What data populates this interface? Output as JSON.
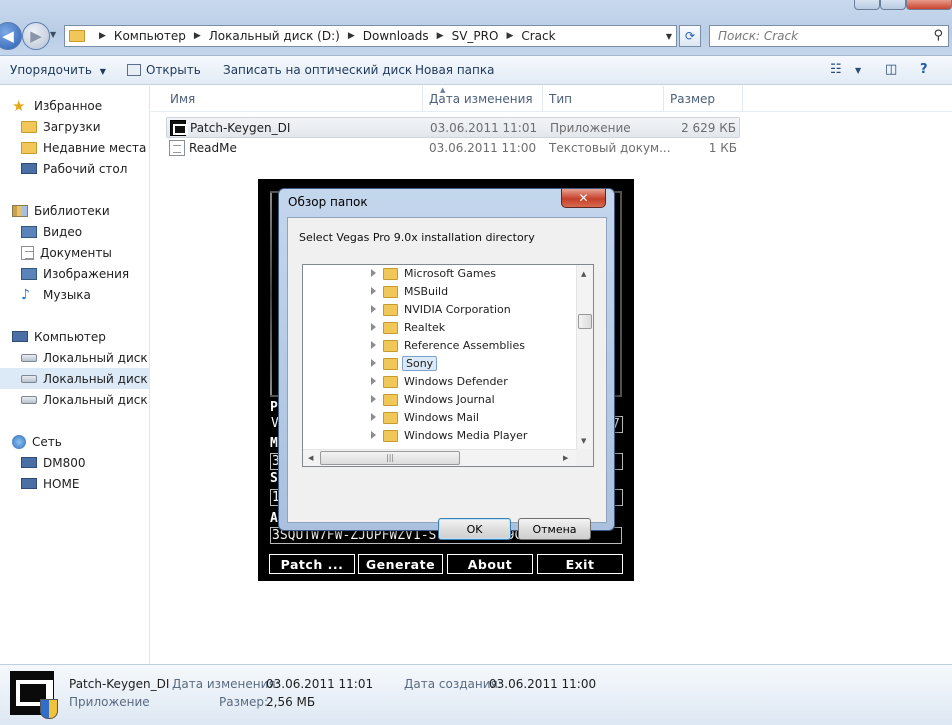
{
  "explorer": {
    "address": {
      "crumbs": [
        "Компьютер",
        "Локальный диск (D:)",
        "Downloads",
        "SV_PRO",
        "Crack"
      ]
    },
    "search": {
      "placeholder": "Поиск: Crack"
    },
    "toolbar": {
      "organize": "Упорядочить",
      "open": "Открыть",
      "burn": "Записать на оптический диск",
      "new_folder": "Новая папка"
    },
    "nav": {
      "favorites": "Избранное",
      "downloads": "Загрузки",
      "recent": "Недавние места",
      "desktop": "Рабочий стол",
      "libraries": "Библиотеки",
      "video": "Видео",
      "documents": "Документы",
      "images": "Изображения",
      "music": "Музыка",
      "computer": "Компьютер",
      "drive_c": "Локальный диск (C:)",
      "drive_d": "Локальный диск (D:)",
      "drive_e": "Локальный диск (E:)",
      "network": "Сеть",
      "dm800": "DM800",
      "home": "HOME"
    },
    "columns": {
      "name": "Имя",
      "date": "Дата изменения",
      "type": "Тип",
      "size": "Размер"
    },
    "files": [
      {
        "name": "Patch-Keygen_DI",
        "date": "03.06.2011 11:01",
        "type": "Приложение",
        "size": "2 629 КБ"
      },
      {
        "name": "ReadMe",
        "date": "03.06.2011 11:00",
        "type": "Текстовый докум...",
        "size": "1 КБ"
      }
    ],
    "details": {
      "name": "Patch-Keygen_DI",
      "kind": "Приложение",
      "modified_label": "Дата изменения:",
      "modified": "03.06.2011 11:01",
      "size_label": "Размер:",
      "size": "2,56 МБ",
      "created_label": "Дата создания:",
      "created": "03.06.2011 11:00"
    }
  },
  "keygen": {
    "letters": [
      "P",
      "V",
      "M",
      "3",
      "S",
      "1",
      "A"
    ],
    "field_v_tail": "7",
    "key": "3SQUTW7FW-ZJUPFWZV1-ST6R6J3T4-9GZR8B17",
    "buttons": {
      "patch": "Patch ...",
      "generate": "Generate",
      "about": "About",
      "exit": "Exit"
    }
  },
  "dialog": {
    "title": "Обзор папок",
    "close_glyph": "✕",
    "prompt": "Select Vegas Pro 9.0x installation directory",
    "folders": [
      "Microsoft Games",
      "MSBuild",
      "NVIDIA Corporation",
      "Realtek",
      "Reference Assemblies",
      "Sony",
      "Windows Defender",
      "Windows Journal",
      "Windows Mail",
      "Windows Media Player"
    ],
    "selected_folder": "Sony",
    "ok": "OK",
    "cancel": "Отмена"
  }
}
